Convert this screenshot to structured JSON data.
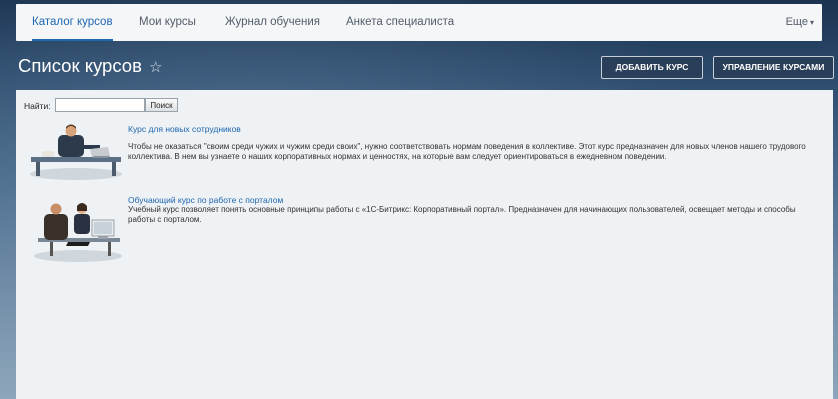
{
  "nav": {
    "tabs": [
      {
        "label": "Каталог курсов",
        "active": true
      },
      {
        "label": "Мои курсы",
        "active": false
      },
      {
        "label": "Журнал обучения",
        "active": false
      },
      {
        "label": "Анкета специалиста",
        "active": false
      }
    ],
    "more_label": "Еще",
    "more_caret": "▾"
  },
  "header": {
    "title": "Список курсов",
    "star": "☆",
    "add_course_label": "Добавить курс",
    "manage_courses_label": "Управление курсами"
  },
  "search": {
    "label": "Найти:",
    "value": "",
    "button_label": "Поиск"
  },
  "courses": [
    {
      "title": "Курс для новых сотрудников",
      "description": "Чтобы не оказаться \"своим среди чужих и чужим среди своих\", нужно соответствовать нормам поведения в коллективе. Этот курс предназначен для новых членов нашего трудового коллектива. В нем вы узнаете о наших корпоративных нормах и ценностях, на которые вам следует ориентироваться в ежедневном поведении."
    },
    {
      "title": "Обучающий курс по работе с порталом",
      "description": "Учебный курс позволяет понять основные принципы работы с «1С-Битрикс: Корпоративный портал». Предназначен для начинающих пользователей, освещает методы и способы работы с порталом."
    }
  ],
  "colors": {
    "accent": "#2067b0",
    "content_bg": "#eef2f4",
    "topbar_bg": "#f4f6f8"
  }
}
